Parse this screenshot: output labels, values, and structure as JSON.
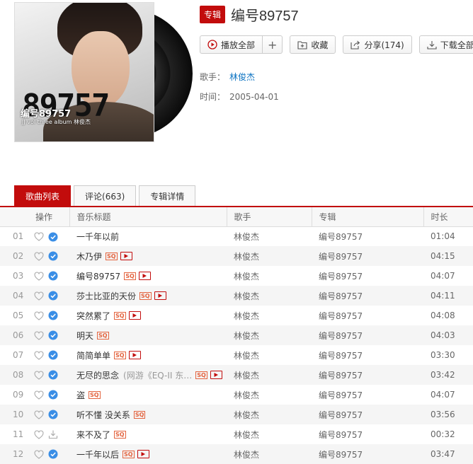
{
  "album": {
    "badge": "专辑",
    "title": "编号89757",
    "cover_brand": "89757",
    "cover_title": "编号89757",
    "cover_sub": "JJ vol three album 林俊杰",
    "artist_label": "歌手：",
    "artist": "林俊杰",
    "date_label": "时间：",
    "date": "2005-04-01"
  },
  "buttons": {
    "play_all": "播放全部",
    "add": "+",
    "collect": "收藏",
    "share": "分享(174)",
    "download": "下载全部"
  },
  "tabs": [
    {
      "label": "歌曲列表"
    },
    {
      "label": "评论(663)"
    },
    {
      "label": "专辑详情"
    }
  ],
  "table": {
    "headers": [
      "操作",
      "音乐标题",
      "歌手",
      "专辑",
      "时长"
    ],
    "rows": [
      {
        "num": "01",
        "title": "一千年以前",
        "subtitle": "",
        "sq": false,
        "mv": false,
        "downloaded": true,
        "artist": "林俊杰",
        "album": "编号89757",
        "duration": "01:04"
      },
      {
        "num": "02",
        "title": "木乃伊",
        "subtitle": "",
        "sq": true,
        "mv": true,
        "downloaded": true,
        "artist": "林俊杰",
        "album": "编号89757",
        "duration": "04:15"
      },
      {
        "num": "03",
        "title": "编号89757",
        "subtitle": "",
        "sq": true,
        "mv": true,
        "downloaded": true,
        "artist": "林俊杰",
        "album": "编号89757",
        "duration": "04:07"
      },
      {
        "num": "04",
        "title": "莎士比亚的天份",
        "subtitle": "",
        "sq": true,
        "mv": true,
        "downloaded": true,
        "artist": "林俊杰",
        "album": "编号89757",
        "duration": "04:11"
      },
      {
        "num": "05",
        "title": "突然累了",
        "subtitle": "",
        "sq": true,
        "mv": true,
        "downloaded": true,
        "artist": "林俊杰",
        "album": "编号89757",
        "duration": "04:08"
      },
      {
        "num": "06",
        "title": "明天",
        "subtitle": "",
        "sq": true,
        "mv": false,
        "downloaded": true,
        "artist": "林俊杰",
        "album": "编号89757",
        "duration": "04:03"
      },
      {
        "num": "07",
        "title": "简简单单",
        "subtitle": "",
        "sq": true,
        "mv": true,
        "downloaded": true,
        "artist": "林俊杰",
        "album": "编号89757",
        "duration": "03:30"
      },
      {
        "num": "08",
        "title": "无尽的思念",
        "subtitle": "(网游《EQ-II 东…",
        "sq": true,
        "mv": true,
        "downloaded": true,
        "artist": "林俊杰",
        "album": "编号89757",
        "duration": "03:42"
      },
      {
        "num": "09",
        "title": "盗",
        "subtitle": "",
        "sq": true,
        "mv": false,
        "downloaded": true,
        "artist": "林俊杰",
        "album": "编号89757",
        "duration": "04:07"
      },
      {
        "num": "10",
        "title": "听不懂 没关系",
        "subtitle": "",
        "sq": true,
        "mv": false,
        "downloaded": true,
        "artist": "林俊杰",
        "album": "编号89757",
        "duration": "03:56"
      },
      {
        "num": "11",
        "title": "来不及了",
        "subtitle": "",
        "sq": true,
        "mv": false,
        "downloaded": false,
        "artist": "林俊杰",
        "album": "编号89757",
        "duration": "00:32"
      },
      {
        "num": "12",
        "title": "一千年以后",
        "subtitle": "",
        "sq": true,
        "mv": true,
        "downloaded": true,
        "artist": "林俊杰",
        "album": "编号89757",
        "duration": "03:47"
      }
    ]
  },
  "icons": {
    "play": "play-circle-icon",
    "collect": "folder-plus-icon",
    "share": "share-icon",
    "download": "download-icon",
    "like": "heart-icon",
    "downloaded": "check-circle-icon",
    "sq": "sq-badge-icon",
    "mv": "mv-play-icon"
  },
  "colors": {
    "accent": "#c20c0c",
    "link": "#0c73c2",
    "downloaded": "#3a8ee6",
    "sq": "#e3633e"
  }
}
